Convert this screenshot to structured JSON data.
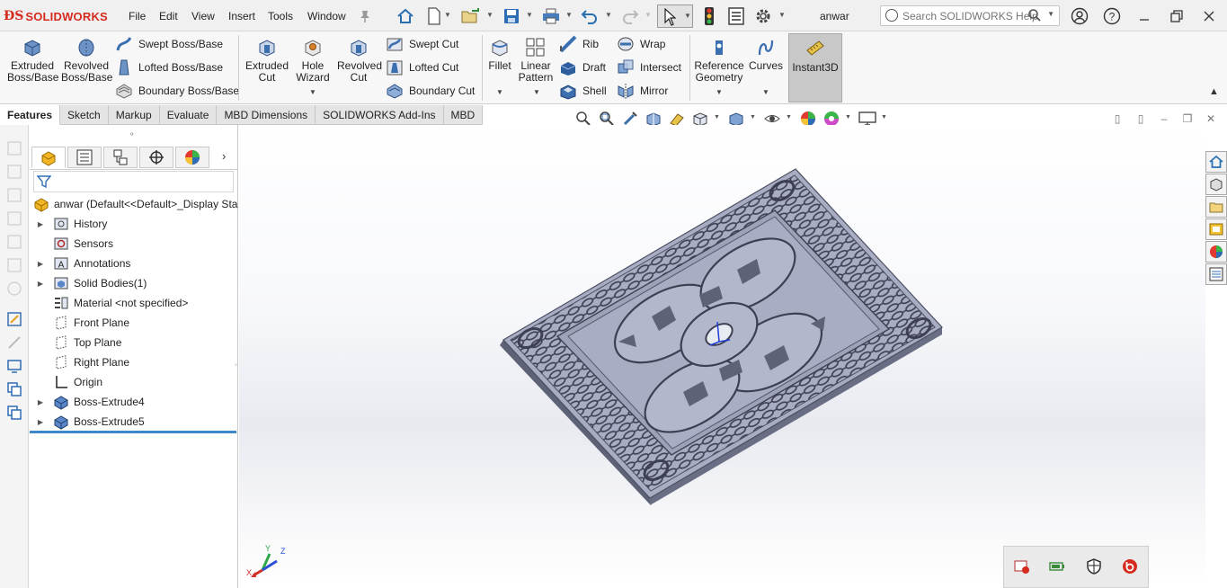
{
  "app": {
    "logo_text": "SOLIDWORKS",
    "document_name": "anwar"
  },
  "menu": [
    "File",
    "Edit",
    "View",
    "Insert",
    "Tools",
    "Window"
  ],
  "search": {
    "placeholder": "Search SOLIDWORKS Help"
  },
  "ribbon": {
    "extruded_boss": "Extruded Boss/Base",
    "revolved_boss": "Revolved Boss/Base",
    "swept_boss": "Swept Boss/Base",
    "lofted_boss": "Lofted Boss/Base",
    "boundary_boss": "Boundary Boss/Base",
    "extruded_cut": "Extruded Cut",
    "hole_wizard": "Hole Wizard",
    "revolved_cut": "Revolved Cut",
    "swept_cut": "Swept Cut",
    "lofted_cut": "Lofted Cut",
    "boundary_cut": "Boundary Cut",
    "fillet": "Fillet",
    "linear_pattern": "Linear Pattern",
    "rib": "Rib",
    "draft": "Draft",
    "shell": "Shell",
    "wrap": "Wrap",
    "intersect": "Intersect",
    "mirror": "Mirror",
    "reference_geometry": "Reference Geometry",
    "curves": "Curves",
    "instant3d": "Instant3D"
  },
  "tabs": [
    "Features",
    "Sketch",
    "Markup",
    "Evaluate",
    "MBD Dimensions",
    "SOLIDWORKS Add-Ins",
    "MBD"
  ],
  "active_tab": "Features",
  "tree": {
    "root": "anwar  (Default<<Default>_Display Sta",
    "items": [
      {
        "label": "History",
        "expandable": true,
        "icon": "history-folder-icon"
      },
      {
        "label": "Sensors",
        "expandable": false,
        "icon": "sensors-icon"
      },
      {
        "label": "Annotations",
        "expandable": true,
        "icon": "annotations-icon"
      },
      {
        "label": "Solid Bodies(1)",
        "expandable": true,
        "icon": "solid-bodies-icon"
      },
      {
        "label": "Material <not specified>",
        "expandable": false,
        "icon": "material-icon"
      },
      {
        "label": "Front Plane",
        "expandable": false,
        "icon": "plane-icon"
      },
      {
        "label": "Top Plane",
        "expandable": false,
        "icon": "plane-icon"
      },
      {
        "label": "Right Plane",
        "expandable": false,
        "icon": "plane-icon"
      },
      {
        "label": "Origin",
        "expandable": false,
        "icon": "origin-icon"
      },
      {
        "label": "Boss-Extrude4",
        "expandable": true,
        "icon": "boss-extrude-icon"
      },
      {
        "label": "Boss-Extrude5",
        "expandable": true,
        "icon": "boss-extrude-icon"
      }
    ]
  },
  "triad": {
    "x": "X",
    "y": "Y",
    "z": "Z"
  },
  "colors": {
    "brand_red": "#d52b1e",
    "model_face": "#a9adc3",
    "model_shadow": "#5e6276",
    "rollback_bar": "#3c88c8",
    "selected_tool_bg": "#c8c8c8"
  }
}
